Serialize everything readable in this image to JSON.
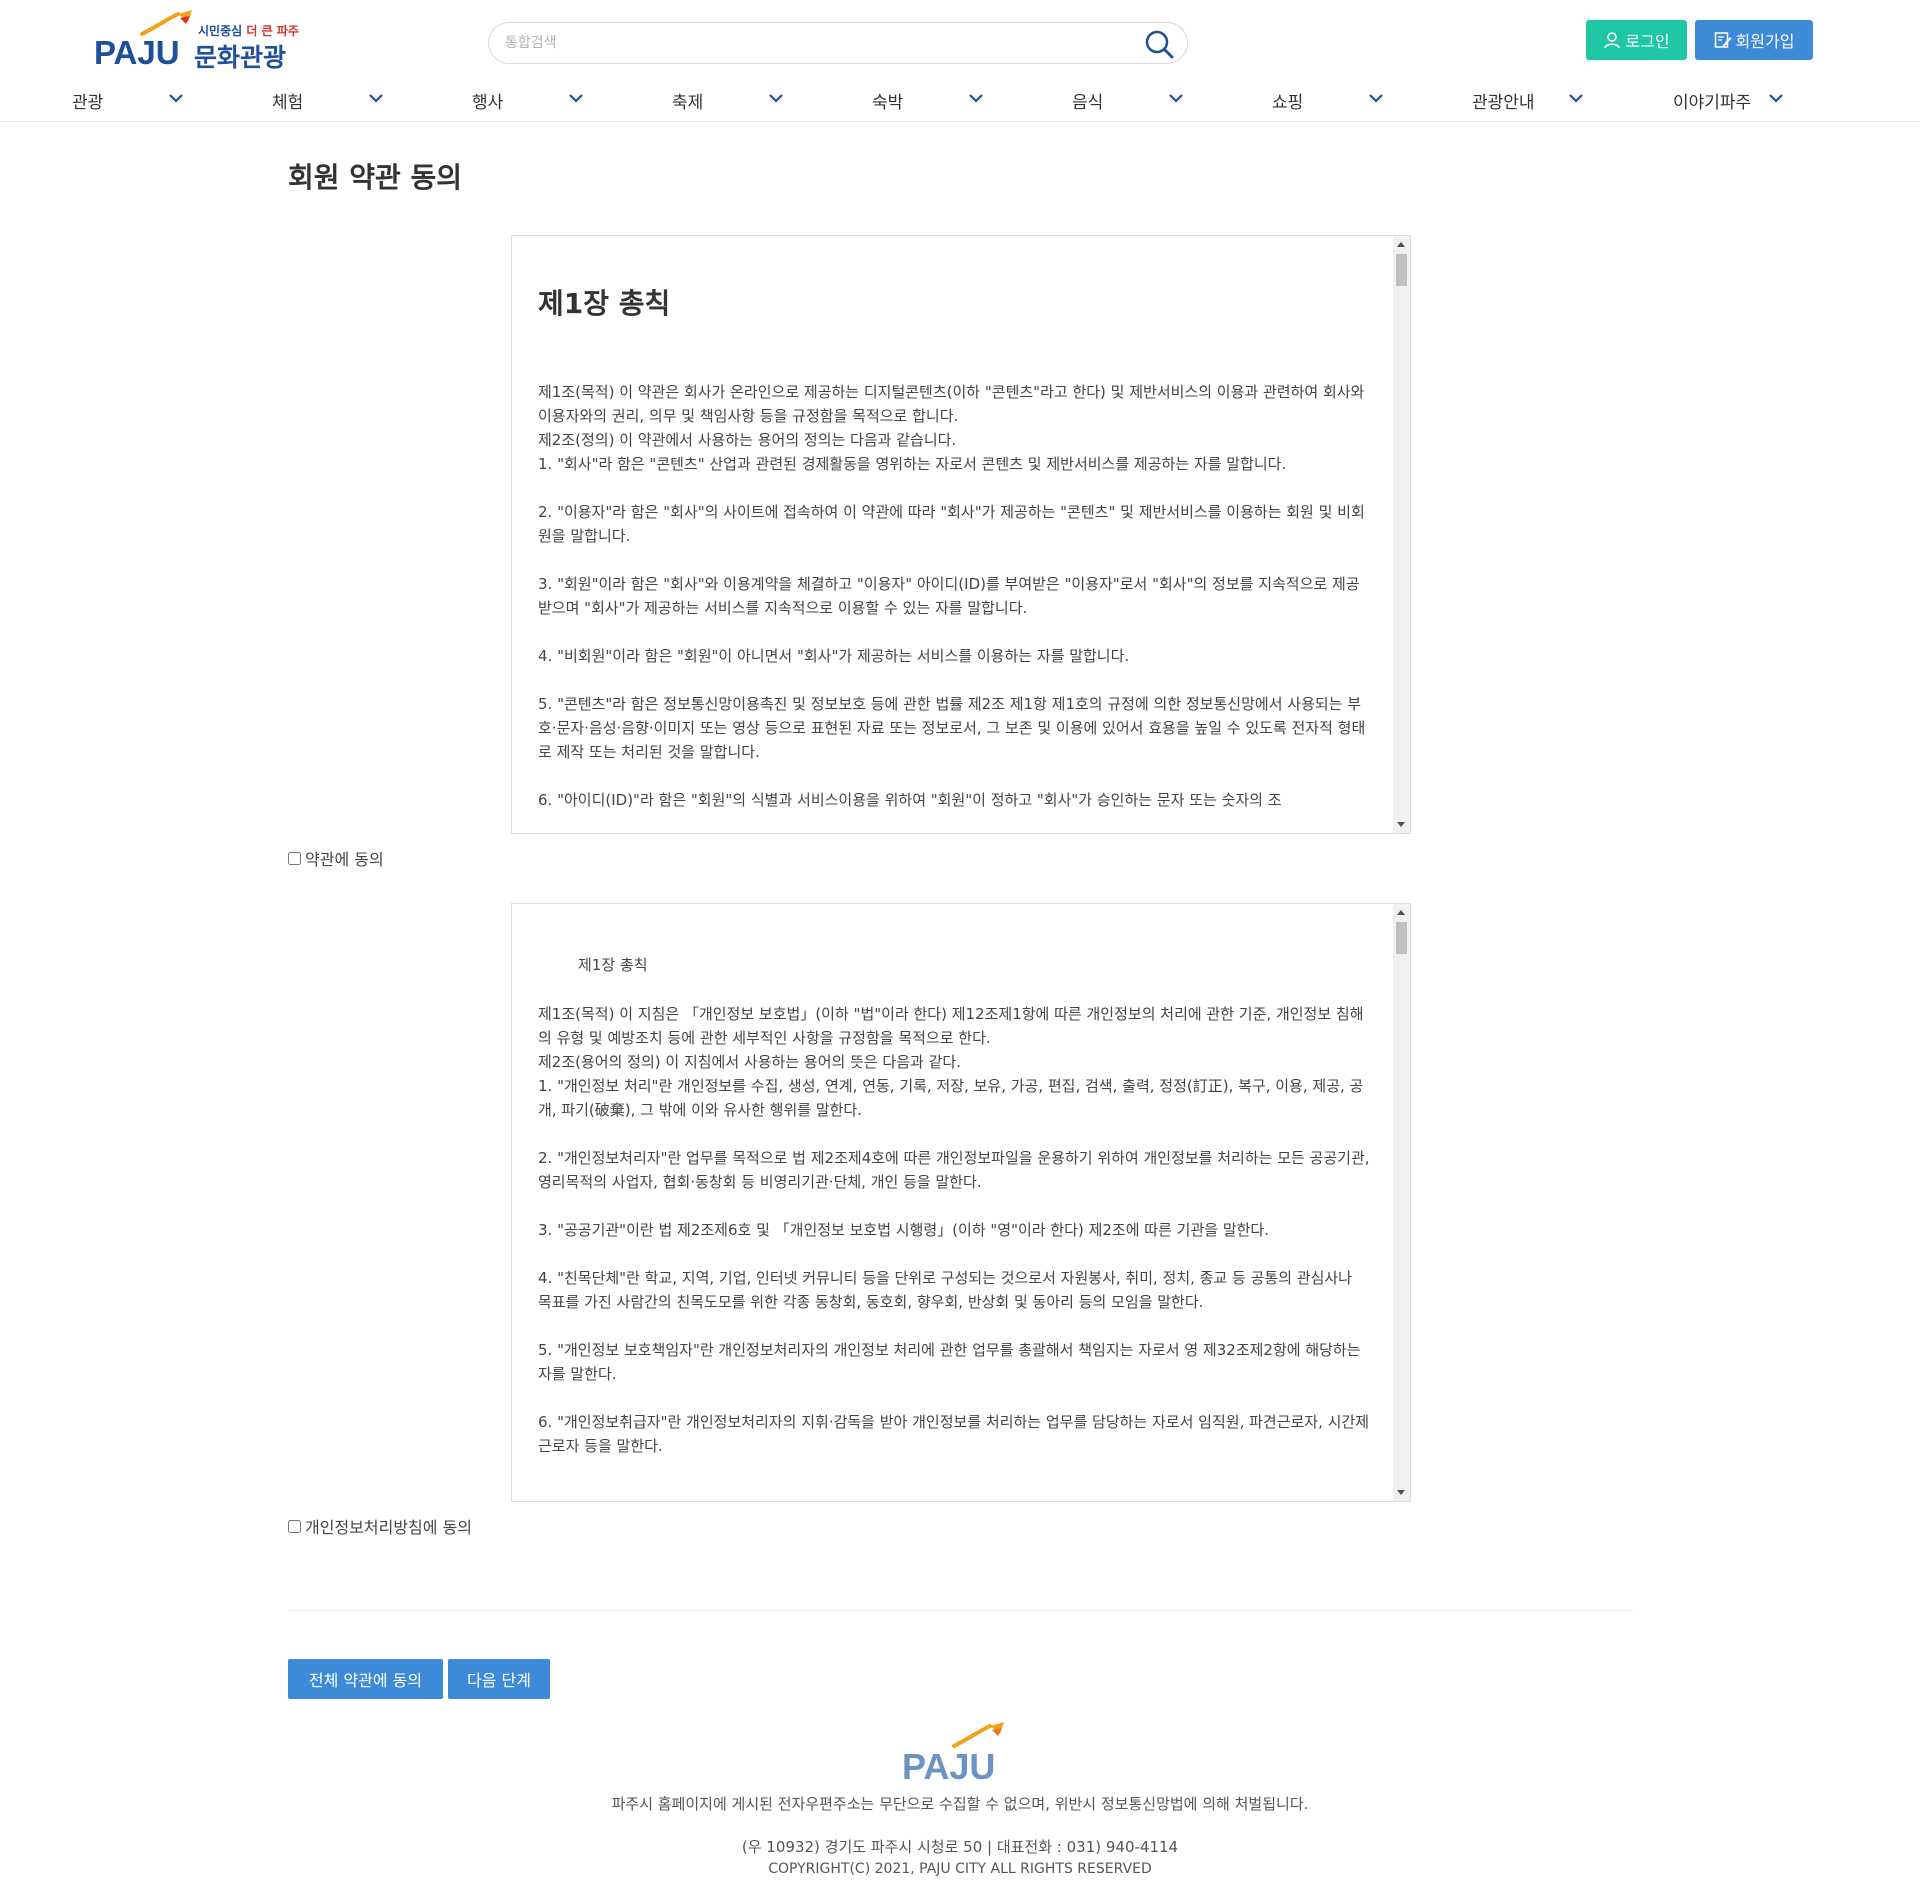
{
  "header": {
    "logo": {
      "word": "PAJU",
      "sub_prefix": "시민중심",
      "sub_highlight": "더 큰 파주",
      "sub_main": "문화관광"
    },
    "search": {
      "placeholder": "통합검색",
      "icon": "search-icon"
    },
    "login_label": "로그인",
    "join_label": "회원가입",
    "colors": {
      "login_bg": "#1fc6a4",
      "join_bg": "#3d8ad9",
      "brand": "#1d4f9a",
      "nav_chevron": "#2b4a9e"
    },
    "nav": [
      {
        "label": "관광"
      },
      {
        "label": "체험"
      },
      {
        "label": "행사"
      },
      {
        "label": "축제"
      },
      {
        "label": "숙박"
      },
      {
        "label": "음식"
      },
      {
        "label": "쇼핑"
      },
      {
        "label": "관광안내"
      },
      {
        "label": "이야기파주"
      }
    ]
  },
  "main": {
    "title": "회원 약관 동의",
    "terms": {
      "heading": "제1장 총칙",
      "paragraphs": [
        "제1조(목적) 이 약관은 회사가 온라인으로 제공하는 디지털콘텐츠(이하 \"콘텐츠\"라고 한다) 및 제반서비스의 이용과 관련하여 회사와 이용자와의 권리, 의무 및 책임사항 등을 규정함을 목적으로 합니다.",
        "제2조(정의) 이 약관에서 사용하는 용어의 정의는 다음과 같습니다.",
        "1. \"회사\"라 함은 \"콘텐츠\" 산업과 관련된 경제활동을 영위하는 자로서 콘텐츠 및 제반서비스를 제공하는 자를 말합니다.",
        "2. \"이용자\"라 함은 \"회사\"의 사이트에 접속하여 이 약관에 따라 \"회사\"가 제공하는 \"콘텐츠\" 및 제반서비스를 이용하는 회원 및 비회원을 말합니다.",
        "3. \"회원\"이라 함은 \"회사\"와 이용계약을 체결하고 \"이용자\" 아이디(ID)를 부여받은 \"이용자\"로서 \"회사\"의 정보를 지속적으로 제공받으며 \"회사\"가 제공하는 서비스를 지속적으로 이용할 수 있는 자를 말합니다.",
        "4. \"비회원\"이라 함은 \"회원\"이 아니면서 \"회사\"가 제공하는 서비스를 이용하는 자를 말합니다.",
        "5. \"콘텐츠\"라 함은 정보통신망이용촉진 및 정보보호 등에 관한 법률 제2조 제1항 제1호의 규정에 의한 정보통신망에서 사용되는 부호·문자·음성·음향·이미지 또는 영상 등으로 표현된 자료 또는 정보로서, 그 보존 및 이용에 있어서 효용을 높일 수 있도록 전자적 형태로 제작 또는 처리된 것을 말합니다.",
        "6. \"아이디(ID)\"라 함은 \"회원\"의 식별과 서비스이용을 위하여 \"회원\"이 정하고 \"회사\"가 승인하는 문자 또는 숫자의 조"
      ],
      "agree_label": "약관에 동의"
    },
    "privacy": {
      "heading": "제1장 총칙",
      "paragraphs": [
        " 제1조(목적) 이 지침은 「개인정보 보호법」(이하 \"법\"이라 한다) 제12조제1항에 따른 개인정보의 처리에 관한 기준, 개인정보 침해의 유형 및 예방조치 등에 관한 세부적인 사항을 규정함을 목적으로 한다.",
        " 제2조(용어의 정의) 이 지침에서 사용하는 용어의 뜻은 다음과 같다.",
        "1. \"개인정보 처리\"란 개인정보를 수집, 생성, 연계, 연동, 기록, 저장, 보유, 가공, 편집, 검색, 출력, 정정(訂正), 복구, 이용, 제공, 공개, 파기(破棄), 그 밖에 이와 유사한 행위를 말한다.",
        "2. \"개인정보처리자\"란 업무를 목적으로 법 제2조제4호에 따른 개인정보파일을 운용하기 위하여 개인정보를 처리하는 모든 공공기관, 영리목적의 사업자, 협회·동창회 등 비영리기관·단체, 개인 등을 말한다.",
        "3. \"공공기관\"이란 법 제2조제6호 및 「개인정보 보호법 시행령」(이하 \"영\"이라 한다) 제2조에 따른 기관을 말한다.",
        "4. \"친목단체\"란 학교, 지역, 기업, 인터넷 커뮤니티 등을 단위로 구성되는 것으로서 자원봉사, 취미, 정치, 종교 등 공통의 관심사나 목표를 가진 사람간의 친목도모를 위한 각종 동창회, 동호회, 향우회, 반상회 및 동아리 등의 모임을 말한다.",
        "5. \"개인정보 보호책임자\"란 개인정보처리자의 개인정보 처리에 관한 업무를 총괄해서 책임지는 자로서 영 제32조제2항에 해당하는 자를 말한다.",
        "6. \"개인정보취급자\"란 개인정보처리자의 지휘·감독을 받아 개인정보를 처리하는 업무를 담당하는 자로서 임직원, 파견근로자, 시간제근로자 등을 말한다."
      ],
      "agree_label": "개인정보처리방침에 동의"
    },
    "all_agree_label": "전체 약관에 동의",
    "next_label": "다음 단계"
  },
  "footer": {
    "logo_word": "PAJU",
    "notice": "파주시 홈페이지에 게시된 전자우편주소는 무단으로 수집할 수 없으며, 위반시 정보통신망법에 의해 처벌됩니다.",
    "address": "(우 10932) 경기도 파주시 시청로 50 | 대표전화 : 031) 940-4114",
    "copyright": "COPYRIGHT(C) 2021, PAJU CITY ALL RIGHTS RESERVED"
  }
}
